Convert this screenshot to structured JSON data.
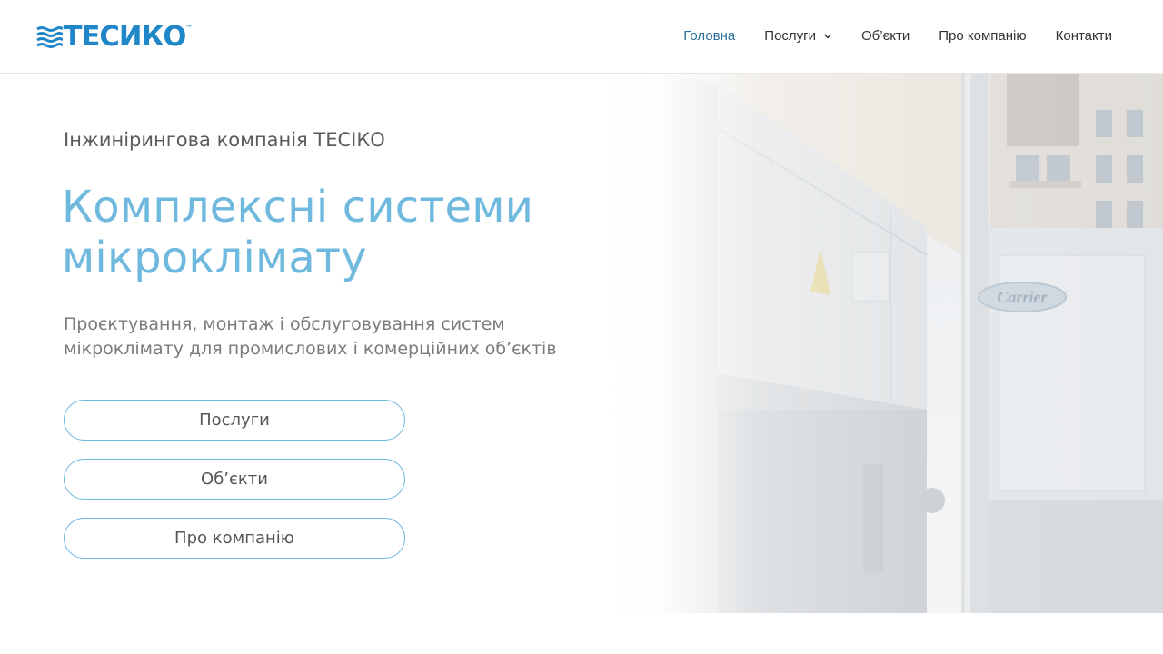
{
  "header": {
    "logo_text": "ТЕСИКО",
    "logo_tm": "™",
    "nav": [
      {
        "label": "Головна",
        "active": true
      },
      {
        "label": "Послуги",
        "has_dropdown": true
      },
      {
        "label": "Об’єкти"
      },
      {
        "label": "Про компанію"
      },
      {
        "label": "Контакти"
      }
    ]
  },
  "hero": {
    "eyebrow": "Інжинірингова компанія ТЕСІКО",
    "headline_line1": "Комплексні системи",
    "headline_line2": "мікроклімату",
    "subtitle_line1": "Проєктування, монтаж і обслуговування систем",
    "subtitle_line2": "мікроклімату для промислових і комерційних об’єктів",
    "buttons": [
      {
        "label": "Послуги"
      },
      {
        "label": "Об’єкти"
      },
      {
        "label": "Про компанію"
      }
    ],
    "image_brand_label": "Carrier"
  },
  "colors": {
    "accent": "#6fb9df",
    "logo": "#1f86c8",
    "nav_active": "#2a6f9c"
  }
}
